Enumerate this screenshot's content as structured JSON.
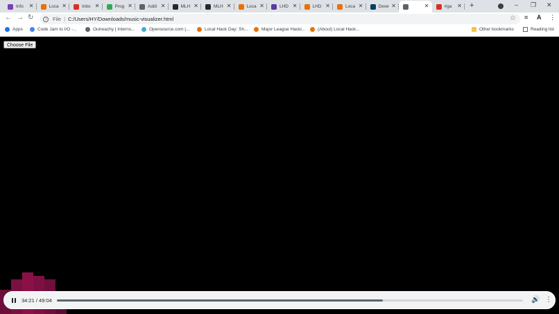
{
  "browser": {
    "tabs": [
      {
        "title": "Info",
        "favicon_color": "#7b3fb6",
        "active": false
      },
      {
        "title": "Loca",
        "favicon_color": "#e8710a",
        "active": false
      },
      {
        "title": "Inbo",
        "favicon_color": "#d93025",
        "active": false
      },
      {
        "title": "Prog",
        "favicon_color": "#34a853",
        "active": false
      },
      {
        "title": "Addi",
        "favicon_color": "#5f6368",
        "active": false
      },
      {
        "title": "MLH",
        "favicon_color": "#24292e",
        "active": false
      },
      {
        "title": "MLH",
        "favicon_color": "#24292e",
        "active": false
      },
      {
        "title": "Loca",
        "favicon_color": "#e8710a",
        "active": false
      },
      {
        "title": "LHD",
        "favicon_color": "#5c3d99",
        "active": false
      },
      {
        "title": "LHD",
        "favicon_color": "#e8710a",
        "active": false
      },
      {
        "title": "Loca",
        "favicon_color": "#e8710a",
        "active": false
      },
      {
        "title": "Deve",
        "favicon_color": "#0a3d62",
        "active": false
      },
      {
        "title": "",
        "favicon_color": "#5f6368",
        "active": true
      },
      {
        "title": "#ga",
        "favicon_color": "#d93025",
        "active": false
      }
    ],
    "new_tab_label": "+",
    "url_scheme": "File",
    "url": "C:/Users/HY/Downloads/music-visualizer.html",
    "bookmarks": [
      {
        "label": "Apps",
        "icon": "apps-grid-icon",
        "color": "#1a73e8"
      },
      {
        "label": "Code Jam to I/O -...",
        "icon": "google-icon",
        "color": "#4285f4"
      },
      {
        "label": "Outreachy | Interns...",
        "icon": "globe-icon",
        "color": "#5f6368"
      },
      {
        "label": "Opensource.com |...",
        "icon": "opensource-icon",
        "color": "#4aa8d8"
      },
      {
        "label": "Local Hack Day: Sh...",
        "icon": "lhd-icon",
        "color": "#e8710a"
      },
      {
        "label": "Major League Hacki...",
        "icon": "lhd-icon",
        "color": "#e8710a"
      },
      {
        "label": "(About) Local Hack...",
        "icon": "lhd-icon",
        "color": "#e8710a"
      }
    ],
    "other_bookmarks": "Other bookmarks",
    "reading_list": "Reading list"
  },
  "page": {
    "choose_file_label": "Choose File",
    "visualizer_levels": [
      0.35,
      0.5,
      0.6,
      0.55,
      0.5,
      0.25
    ],
    "visualizer_colors": [
      "#6b0f3a",
      "#7a1040",
      "#8a1146",
      "#7d1042",
      "#6e0f3c",
      "#5a0d32"
    ]
  },
  "player": {
    "time_display": "34:21 / 49:04",
    "progress": 0.7
  }
}
